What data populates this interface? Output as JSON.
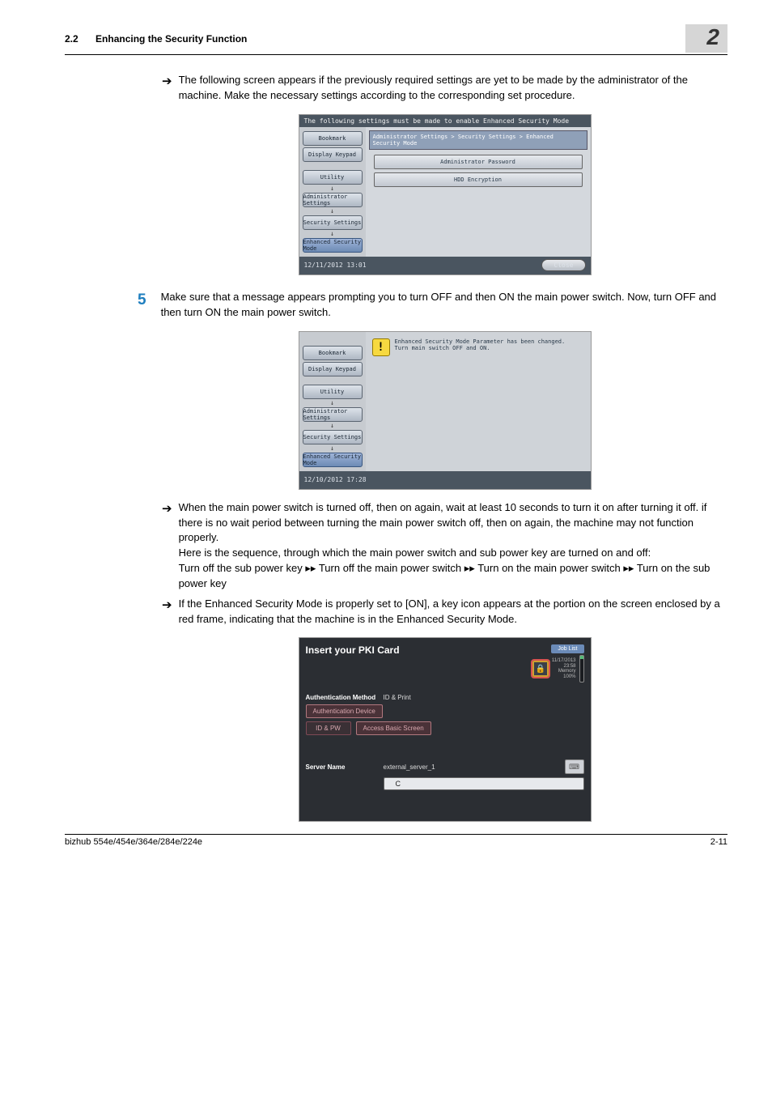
{
  "header": {
    "section_num": "2.2",
    "section_title": "Enhancing the Security Function",
    "chapter_marker": "2"
  },
  "content": {
    "intro_bullet": "The following screen appears if the previously required settings are yet to be made by the administrator of the machine. Make the necessary settings according to the corresponding set procedure.",
    "step_num": "5",
    "step_text": "Make sure that a message appears prompting you to turn OFF and then ON the main power switch. Now, turn OFF and then turn ON the main power switch.",
    "power_note1": "When the main power switch is turned off, then on again, wait at least 10 seconds to turn it on after turning it off. if there is no wait period between turning the main power switch off, then on again, the machine may not function properly.",
    "power_note2": "Here is the sequence, through which the main power switch and sub power key are turned on and off:",
    "power_note3a": "Turn off the sub power key ",
    "power_note3b": " Turn off the main power switch ",
    "power_note3c": " Turn on the main power switch ",
    "power_note3d": " Turn on the sub power key",
    "keyicon_note": "If the Enhanced Security Mode is properly set to [ON], a key icon appears at the portion on the screen enclosed by a red frame, indicating that the machine is in the Enhanced Security Mode."
  },
  "panel1": {
    "topbar": "The following settings must be made to enable Enhanced Security Mode",
    "side": {
      "bookmark": "Bookmark",
      "display_keypad": "Display Keypad",
      "utility": "Utility",
      "admin": "Administrator Settings",
      "security": "Security Settings",
      "enhanced": "Enhanced Security Mode"
    },
    "breadcrumb": "Administrator Settings > Security Settings > Enhanced Security Mode",
    "rows": [
      "Administrator Password",
      "HDD Encryption"
    ],
    "footer_time": "12/11/2012   13:01",
    "close": "Close"
  },
  "panel2": {
    "warn1": "Enhanced Security Mode Parameter has been changed.",
    "warn2": "Turn main switch OFF and ON.",
    "footer_time": "12/10/2012   17:28"
  },
  "panel3": {
    "title": "Insert your PKI Card",
    "job_list": "Job List",
    "date_line": "11/17/2013",
    "time_line": "23:58",
    "memory": "Memory",
    "mem_val": "100%",
    "auth_method_label": "Authentication Method",
    "auth_method_val": "ID & Print",
    "auth_device": "Authentication Device",
    "idpw": "ID & PW",
    "access_basic": "Access Basic Screen",
    "server_name_label": "Server Name",
    "server_name_val": "external_server_1",
    "c_btn": "C"
  },
  "footer": {
    "model": "bizhub 554e/454e/364e/284e/224e",
    "page": "2-11"
  }
}
